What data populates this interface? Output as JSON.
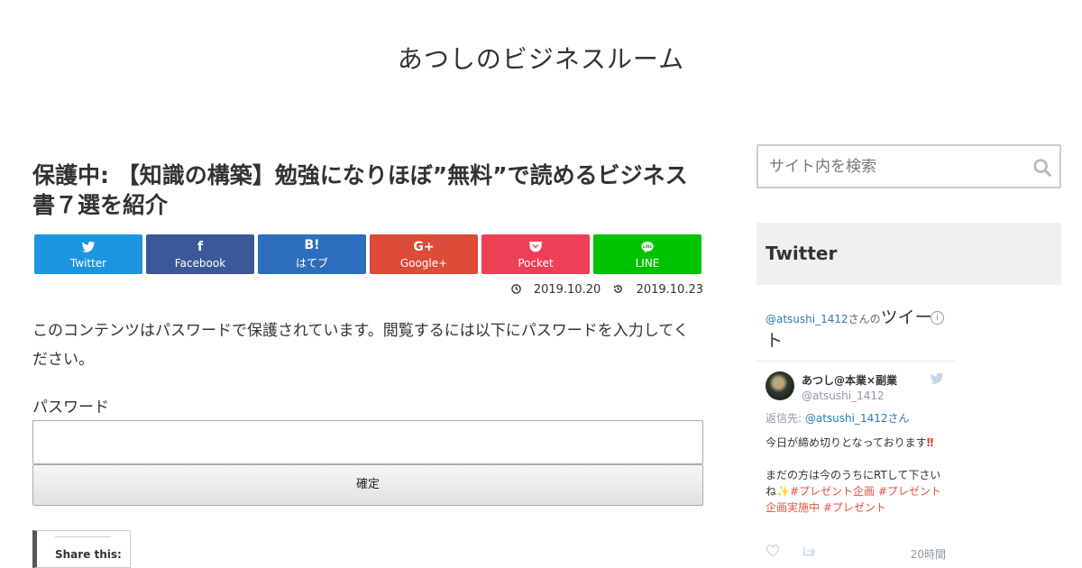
{
  "site": {
    "title": "あつしのビジネスルーム"
  },
  "post": {
    "title": "保護中: 【知識の構築】勉強になりほぼ”無料”で読めるビジネス書７選を紹介",
    "published": "2019.10.20",
    "updated": "2019.10.23",
    "protected_message": "このコンテンツはパスワードで保護されています。閲覧するには以下にパスワードを入力してください。",
    "password_label": "パスワード",
    "password_value": "",
    "submit_label": "確定"
  },
  "share_buttons": [
    {
      "label": "Twitter",
      "color": "#1b95e0",
      "icon": "twitter-icon"
    },
    {
      "label": "Facebook",
      "color": "#3b5998",
      "icon": "facebook-icon",
      "glyph": "f"
    },
    {
      "label": "はてブ",
      "color": "#2c6ebd",
      "icon": "hatena-bookmark-icon",
      "glyph": "B!"
    },
    {
      "label": "Google+",
      "color": "#dd4b39",
      "icon": "google-plus-icon",
      "glyph": "G+"
    },
    {
      "label": "Pocket",
      "color": "#ef3f56",
      "icon": "pocket-icon"
    },
    {
      "label": "LINE",
      "color": "#00c300",
      "icon": "line-icon"
    }
  ],
  "share_this": {
    "label": "Share this:"
  },
  "sidebar": {
    "search_placeholder": "サイト内を検索",
    "twitter_widget_title": "Twitter",
    "timeline": {
      "handle": "@atsushi_1412",
      "suffix": "さんの",
      "title_big": "ツイート",
      "tweet": {
        "name": "あつし@本業×副業",
        "screen_name": "@atsushi_1412",
        "reply_prefix": "返信先: ",
        "reply_handle": "@atsushi_1412さん",
        "line1": "今日が締め切りとなっております",
        "emoji1": "‼",
        "line2": "まだの方は今のうちにRTして下さいね",
        "emoji2": "✨",
        "tag1": "#プレゼント企画",
        "tag2": "#プレゼント企画実施中",
        "tag3": "#プレゼント",
        "time": "20時間"
      }
    }
  }
}
